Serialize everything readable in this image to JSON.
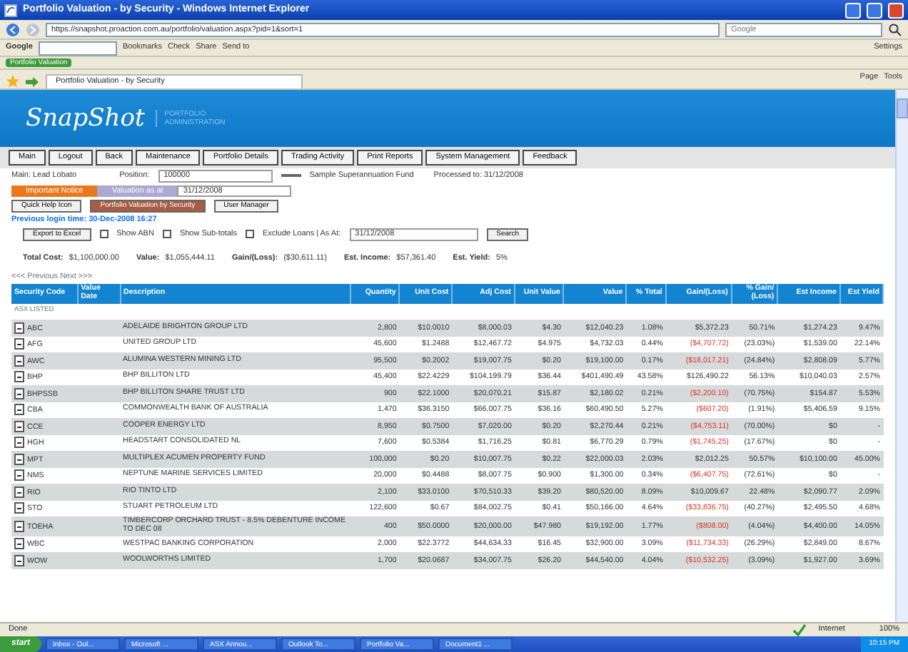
{
  "window": {
    "title": "Portfolio Valuation - by Security - Windows Internet Explorer"
  },
  "browser": {
    "google_label": "Google",
    "address": "https://snapshot.proaction.com.au/portfolio/valuation.aspx?pid=1&sort=1",
    "search_placeholder": "Google",
    "google_items": [
      "Bookmarks",
      "Check",
      "Share",
      "Send to"
    ],
    "google_right": "Settings",
    "favorite": "Portfolio Valuation",
    "tab": "Portfolio Valuation - by Security",
    "commands": [
      "Page",
      "Tools"
    ]
  },
  "app": {
    "logo": "SnapShot",
    "tagline": "PORTFOLIO ADMINISTRATION",
    "nav": [
      "Main",
      "Logout",
      "Back",
      "Maintenance",
      "Portfolio Details",
      "Trading Activity",
      "Print Reports",
      "System Management",
      "Feedback"
    ],
    "user_label": "Main: Lead Lobato",
    "position_label": "Position:",
    "position_value": "100000",
    "fund": "Sample Superannuation Fund",
    "processed": "Processed to: 31/12/2008",
    "tabs": [
      {
        "label": "Important Notice",
        "selected": true
      },
      {
        "label": "Valuation as at",
        "selected": false
      }
    ],
    "valuation_date": "31/12/2008",
    "sub_buttons": [
      "Quick Help Icon",
      "Portfolio Valuation by Security",
      "User Manager"
    ],
    "last_login": "Previous login time: 30-Dec-2008 16:27",
    "export": "Export to Excel",
    "options": [
      {
        "label": "Show ABN",
        "checked": false
      },
      {
        "label": "Show Sub-totals",
        "checked": false
      },
      {
        "label": "Exclude Loans | As At:",
        "checked": false
      }
    ],
    "as_at": "31/12/2008",
    "search": "Search",
    "totals": [
      {
        "label": "Total Cost:",
        "value": "$1,100,000.00"
      },
      {
        "label": "Value:",
        "value": "$1,055,444.11"
      },
      {
        "label": "Gain/(Loss):",
        "value": "($30,611.11)"
      },
      {
        "label": "Est. Income:",
        "value": "$57,361.40"
      },
      {
        "label": "Est. Yield:",
        "value": "5%"
      }
    ],
    "pager": "<<< Previous  Next >>>",
    "table": {
      "columns": [
        "Security Code",
        "Value Date",
        "Description",
        "Quantity",
        "Unit Cost",
        "Adj Cost",
        "Unit Value",
        "Value",
        "% Total",
        "Gain/(Loss)",
        "% Gain/ (Loss)",
        "Est Income",
        "Est Yield"
      ],
      "group": "ASX LISTED",
      "rows": [
        {
          "cells": [
            "ABC",
            "",
            "ADELAIDE BRIGHTON GROUP LTD",
            "2,800",
            "$10.0010",
            "$8,000.03",
            "$4.30",
            "$12,040.23",
            "1.08%",
            "$5,372.23",
            "50.71%",
            "$1,274.23",
            "9.47%"
          ],
          "loss": false
        },
        {
          "cells": [
            "AFG",
            "",
            "UNITED GROUP LTD",
            "45,600",
            "$1.2488",
            "$12,467.72",
            "$4.975",
            "$4,732.03",
            "0.44%",
            "($4,707.72)",
            "(23.03%)",
            "$1,539.00",
            "22.14%"
          ],
          "loss": true
        },
        {
          "cells": [
            "AWC",
            "",
            "ALUMINA WESTERN MINING LTD",
            "95,500",
            "$0.2002",
            "$19,007.75",
            "$0.20",
            "$19,100.00",
            "0.17%",
            "($18,017.21)",
            "(24.84%)",
            "$2,808.09",
            "5.77%"
          ],
          "loss": true
        },
        {
          "cells": [
            "BHP",
            "",
            "BHP BILLITON LTD",
            "45,400",
            "$22.4229",
            "$104,199.79",
            "$36.44",
            "$401,490.49",
            "43.58%",
            "$126,490.22",
            "56.13%",
            "$10,040.03",
            "2.57%"
          ],
          "loss": false
        },
        {
          "cells": [
            "BHPSSB",
            "",
            "BHP BILLITON SHARE TRUST LTD",
            "900",
            "$22.1000",
            "$20,070.21",
            "$15.87",
            "$2,180.02",
            "0.21%",
            "($2,200.10)",
            "(70.75%)",
            "$154.87",
            "5.53%"
          ],
          "loss": true
        },
        {
          "cells": [
            "CBA",
            "",
            "COMMONWEALTH BANK OF AUSTRALIA",
            "1,470",
            "$36.3150",
            "$66,007.75",
            "$36.16",
            "$60,490.50",
            "5.27%",
            "($607.20)",
            "(1.91%)",
            "$5,406.59",
            "9.15%"
          ],
          "loss": true
        },
        {
          "cells": [
            "CCE",
            "",
            "COOPER ENERGY LTD",
            "8,950",
            "$0.7500",
            "$7,020.00",
            "$0.20",
            "$2,270.44",
            "0.21%",
            "($4,753.11)",
            "(70.00%)",
            "$0",
            "-"
          ],
          "loss": true
        },
        {
          "cells": [
            "HGH",
            "",
            "HEADSTART CONSOLIDATED NL",
            "7,600",
            "$0.5384",
            "$1,716.25",
            "$0.81",
            "$6,770.29",
            "0.79%",
            "($1,745.25)",
            "(17.67%)",
            "$0",
            "-"
          ],
          "loss": true
        },
        {
          "cells": [
            "MPT",
            "",
            "MULTIPLEX ACUMEN PROPERTY FUND",
            "100,000",
            "$0.20",
            "$10,007.75",
            "$0.22",
            "$22,000.03",
            "2.03%",
            "$2,012.25",
            "50.57%",
            "$10,100.00",
            "45.00%"
          ],
          "loss": false
        },
        {
          "cells": [
            "NMS",
            "",
            "NEPTUNE MARINE SERVICES LIMITED",
            "20,000",
            "$0.4488",
            "$8,007.75",
            "$0.900",
            "$1,300.00",
            "0.34%",
            "($6,407.75)",
            "(72.61%)",
            "$0",
            "-"
          ],
          "loss": true
        },
        {
          "cells": [
            "RIO",
            "",
            "RIO TINTO LTD",
            "2,100",
            "$33.0100",
            "$70,510.33",
            "$39.20",
            "$80,520.00",
            "8.09%",
            "$10,009.67",
            "22.48%",
            "$2,090.77",
            "2.09%"
          ],
          "loss": false
        },
        {
          "cells": [
            "STO",
            "",
            "STUART PETROLEUM LTD",
            "122,600",
            "$0.67",
            "$84,002.75",
            "$0.41",
            "$50,166.00",
            "4.64%",
            "($33,836.75)",
            "(40.27%)",
            "$2,495.50",
            "4.68%"
          ],
          "loss": true
        },
        {
          "cells": [
            "TOEHA",
            "",
            "TIMBERCORP ORCHARD TRUST - 8.5% DEBENTURE INCOME TO DEC 08",
            "400",
            "$50.0000",
            "$20,000.00",
            "$47.980",
            "$19,192.00",
            "1.77%",
            "($808.00)",
            "(4.04%)",
            "$4,400.00",
            "14.05%"
          ],
          "loss": true
        },
        {
          "cells": [
            "WBC",
            "",
            "WESTPAC BANKING CORPORATION",
            "2,000",
            "$22.3772",
            "$44,634.33",
            "$16.45",
            "$32,900.00",
            "3.09%",
            "($11,734.33)",
            "(26.29%)",
            "$2,849.00",
            "8.67%"
          ],
          "loss": true
        },
        {
          "cells": [
            "WOW",
            "",
            "WOOLWORTHS LIMITED",
            "1,700",
            "$20.0687",
            "$34,007.75",
            "$26.20",
            "$44,540.00",
            "4.04%",
            "($10,532.25)",
            "(3.09%)",
            "$1,927.00",
            "3.69%"
          ],
          "loss": true
        }
      ]
    }
  },
  "status_bar": {
    "text": "Done",
    "zone": "Internet",
    "zoom": "100%"
  },
  "taskbar": {
    "start": "start",
    "items": [
      "Inbox - Out...",
      "Microsoft ...",
      "ASX Annou...",
      "Outlook To...",
      "Portfolio Va...",
      "Document1 ..."
    ],
    "clock": "10:15 PM"
  }
}
